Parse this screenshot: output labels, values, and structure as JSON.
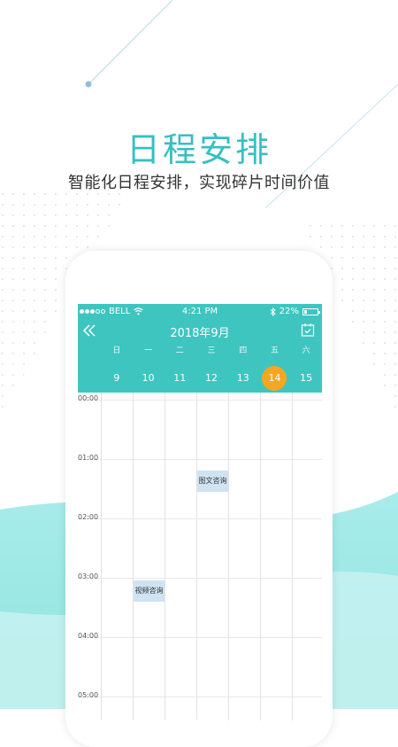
{
  "headline": "日程安排",
  "subline": "智能化日程安排，实现碎片时间价值",
  "colors": {
    "accent": "#37bfc3",
    "header": "#3ec5c0",
    "selected": "#f5a623",
    "event": "#cfe3f2"
  },
  "status": {
    "carrier": "BELL",
    "time": "4:21 PM",
    "battery": "22%"
  },
  "calendar": {
    "month_title": "2018年9月",
    "weekdays": [
      "日",
      "一",
      "二",
      "三",
      "四",
      "五",
      "六"
    ],
    "dates": [
      "9",
      "10",
      "11",
      "12",
      "13",
      "14",
      "15"
    ],
    "selected": "14",
    "times": [
      "00:00",
      "01:00",
      "02:00",
      "03:00",
      "04:00",
      "05:00"
    ],
    "events": [
      {
        "label": "图文咨询",
        "day_index": 3,
        "hour": 1.2
      },
      {
        "label": "视频咨询",
        "day_index": 1,
        "hour": 3.05
      }
    ]
  },
  "icons": {
    "back": "double-chevron-left-icon",
    "calendar": "calendar-check-icon",
    "wifi": "wifi-icon",
    "bluetooth": "bluetooth-icon",
    "battery": "battery-icon"
  }
}
